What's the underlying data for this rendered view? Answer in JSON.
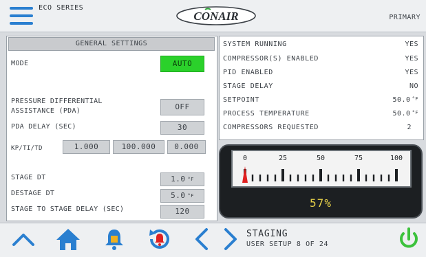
{
  "header": {
    "series": "ECO SERIES",
    "logo_text": "CONAIR",
    "unit_role": "PRIMARY"
  },
  "general_settings": {
    "title": "GENERAL SETTINGS",
    "mode_label": "MODE",
    "mode_value": "AUTO",
    "pda_label": "PRESSURE DIFFERENTIAL ASSISTANCE (PDA)",
    "pda_value": "OFF",
    "pda_delay_label": "PDA DELAY (SEC)",
    "pda_delay_value": "30",
    "kp_ti_td_label": "KP/TI/TD",
    "kp_value": "1.000",
    "ti_value": "100.000",
    "td_value": "0.000",
    "stage_dt_label": "STAGE DT",
    "stage_dt_value": "1.0",
    "destage_dt_label": "DESTAGE DT",
    "destage_dt_value": "5.0",
    "temp_unit": "°F",
    "stage_delay_label": "STAGE TO STAGE DELAY (SEC)",
    "stage_delay_value": "120"
  },
  "status": [
    {
      "label": "SYSTEM RUNNING",
      "value": "YES",
      "unit": ""
    },
    {
      "label": "COMPRESSOR(S) ENABLED",
      "value": "YES",
      "unit": ""
    },
    {
      "label": "PID ENABLED",
      "value": "YES",
      "unit": ""
    },
    {
      "label": "STAGE DELAY",
      "value": "NO",
      "unit": ""
    },
    {
      "label": "SETPOINT",
      "value": "50.0",
      "unit": "°F"
    },
    {
      "label": "PROCESS TEMPERATURE",
      "value": "50.0",
      "unit": "°F"
    },
    {
      "label": "COMPRESSORS REQUESTED",
      "value": "2",
      "unit": ""
    }
  ],
  "gauge": {
    "scale_labels": [
      "0",
      "25",
      "50",
      "75",
      "100"
    ],
    "percent_text": "57%",
    "needle_value": 0,
    "needle_color": "#e02020",
    "readout_color": "#e8d24a"
  },
  "footer": {
    "screen_title": "STAGING",
    "screen_subtitle": "USER SETUP 8 OF 24",
    "icons": [
      "up-arrow-icon",
      "home-icon",
      "alarm-bell-icon",
      "alarm-history-icon",
      "prev-arrow-icon",
      "next-arrow-icon",
      "power-icon"
    ],
    "accent_color": "#2a7fd0",
    "power_color": "#3cc23c"
  }
}
